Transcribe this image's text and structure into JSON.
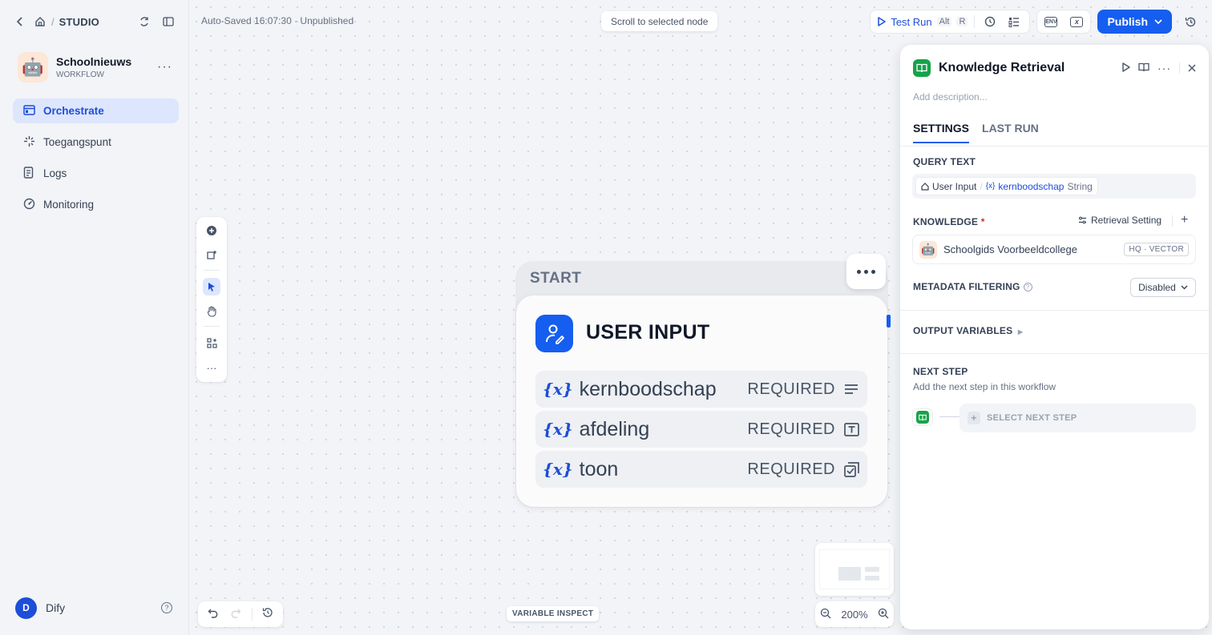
{
  "sidebar": {
    "breadcrumb": "STUDIO",
    "app": {
      "avatar": "🤖",
      "name": "Schoolnieuws",
      "type": "WORKFLOW"
    },
    "nav": [
      {
        "label": "Orchestrate",
        "icon": "orchestrate-icon",
        "active": true
      },
      {
        "label": "Toegangspunt",
        "icon": "access-point-icon",
        "active": false
      },
      {
        "label": "Logs",
        "icon": "logs-icon",
        "active": false
      },
      {
        "label": "Monitoring",
        "icon": "monitoring-icon",
        "active": false
      }
    ],
    "user": {
      "initial": "D",
      "name": "Dify"
    }
  },
  "toolbar": {
    "autosave": "Auto-Saved 16:07:30 · Unpublished",
    "scroll_to_node": "Scroll to selected node",
    "test_run": "Test Run",
    "test_run_kbd_1": "Alt",
    "test_run_kbd_2": "R",
    "env_label": "ENV",
    "publish": "Publish"
  },
  "canvas": {
    "variable_inspect": "VARIABLE INSPECT",
    "zoom": "200%",
    "node": {
      "label": "START",
      "title": "USER INPUT",
      "variables": [
        {
          "name": "kernboodschap",
          "required": "REQUIRED",
          "type_icon": "paragraph-icon"
        },
        {
          "name": "afdeling",
          "required": "REQUIRED",
          "type_icon": "text-input-icon"
        },
        {
          "name": "toon",
          "required": "REQUIRED",
          "type_icon": "select-icon"
        }
      ],
      "var_prefix": "{x}"
    }
  },
  "panel": {
    "title": "Knowledge Retrieval",
    "description_placeholder": "Add description...",
    "tabs": [
      "SETTINGS",
      "LAST RUN"
    ],
    "query_text": {
      "label": "QUERY TEXT",
      "source": "User Input",
      "separator": "/",
      "var_prefix": "{x}",
      "var": "kernboodschap",
      "type": "String"
    },
    "knowledge": {
      "label": "KNOWLEDGE",
      "required_mark": "*",
      "retrieval_setting": "Retrieval Setting",
      "item_avatar": "🤖",
      "item": "Schoolgids Voorbeeldcollege",
      "badge": "HQ · VECTOR"
    },
    "metadata": {
      "label": "METADATA FILTERING",
      "value": "Disabled"
    },
    "output_variables": "OUTPUT VARIABLES",
    "next_step": {
      "label": "NEXT STEP",
      "sub": "Add the next step in this workflow",
      "button": "SELECT NEXT STEP"
    }
  },
  "colors": {
    "accent": "#155eef",
    "knowledge_green": "#16a34a",
    "sidebar_active_bg": "#dde6fd"
  }
}
